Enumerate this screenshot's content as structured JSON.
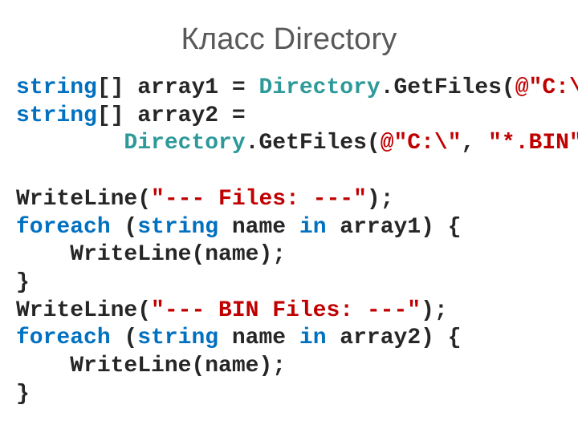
{
  "title": "Класс Directory",
  "code": {
    "l1": {
      "kw1": "string",
      "p1": "[] array1 = ",
      "typ": "Directory",
      "p2": ".GetFiles(",
      "s1": "@\"C:\\\"",
      "p3": ");"
    },
    "l2": {
      "kw1": "string",
      "p1": "[] array2 ="
    },
    "l3": {
      "indent": "        ",
      "typ": "Directory",
      "p1": ".GetFiles(",
      "s1": "@\"C:\\\"",
      "p2": ", ",
      "s2": "\"*.BIN\"",
      "p3": ");"
    },
    "blank1": "",
    "l4": {
      "p1": "WriteLine(",
      "s1": "\"--- Files: ---\"",
      "p2": ");"
    },
    "l5": {
      "kw1": "foreach",
      "p1": " (",
      "kw2": "string",
      "p2": " name ",
      "kw3": "in",
      "p3": " array1) {"
    },
    "l6": {
      "p1": "    WriteLine(name);"
    },
    "l7": {
      "p1": "}"
    },
    "l8": {
      "p1": "WriteLine(",
      "s1": "\"--- BIN Files: ---\"",
      "p2": ");"
    },
    "l9": {
      "kw1": "foreach",
      "p1": " (",
      "kw2": "string",
      "p2": " name ",
      "kw3": "in",
      "p3": " array2) {"
    },
    "l10": {
      "p1": "    WriteLine(name);"
    },
    "l11": {
      "p1": "}"
    }
  }
}
